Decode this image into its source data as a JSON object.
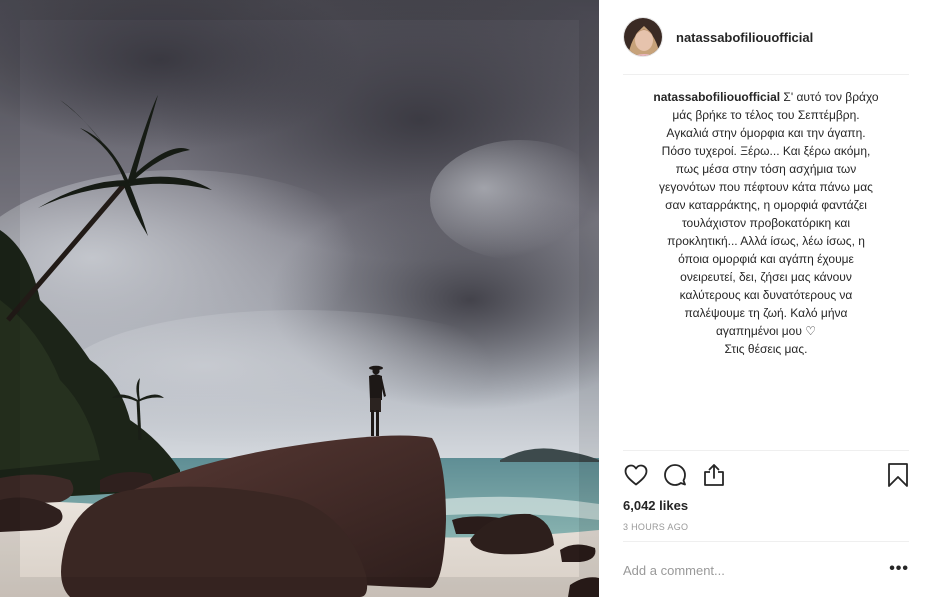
{
  "post": {
    "username": "natassabofiliouofficial",
    "caption_lines": [
      "Σ' αυτό τον βράχο",
      "μάς βρήκε το τέλος του Σεπτέμβρη.",
      "Αγκαλιά στην όμορφια και την άγαπη.",
      "Πόσο τυχεροί. Ξέρω... Και ξέρω ακόμη,",
      "πως μέσα στην τόση ασχήμια των",
      "γεγονότων που πέφτουν κάτα πάνω μας",
      "σαν καταρράκτης, η ομορφιά φαντάζει",
      "τουλάχιστον προβοκατόρικη και",
      "προκλητική... Αλλά ίσως, λέω ίσως, η",
      "όποια ομορφιά και αγάπη έχουμε",
      "ονειρευτεί, δει, ζήσει μας κάνουν",
      "καλύτερους και δυνατότερους να",
      "παλέψουμε τη ζωή. Καλό μήνα",
      "αγαπημένοι μου ♡",
      "Στις θέσεις μας."
    ],
    "likes": "6,042 likes",
    "time_ago": "3 HOURS AGO",
    "comment_placeholder": "Add a comment...",
    "more_label": "•••"
  },
  "icons": {
    "like": "heart-outline",
    "comment": "speech-bubble-outline",
    "share": "share-upload",
    "save": "bookmark-outline"
  },
  "colors": {
    "text": "#262626",
    "muted": "#999999",
    "divider": "#efefef"
  }
}
